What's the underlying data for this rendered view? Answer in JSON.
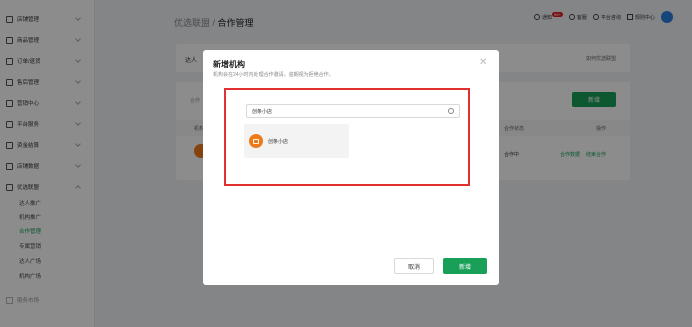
{
  "sidebar": {
    "items": [
      {
        "label": "店铺管理"
      },
      {
        "label": "商品管理"
      },
      {
        "label": "订单/退货"
      },
      {
        "label": "售后管理"
      },
      {
        "label": "营销中心"
      },
      {
        "label": "平台服务"
      },
      {
        "label": "资金结算"
      },
      {
        "label": "店铺数据"
      },
      {
        "label": "优选联盟"
      }
    ],
    "sub_items": [
      {
        "label": "达人推广"
      },
      {
        "label": "机构推广"
      },
      {
        "label": "合作管理"
      },
      {
        "label": "专属营销"
      },
      {
        "label": "达人广场"
      },
      {
        "label": "机构广场"
      }
    ],
    "bottom_label": "服务市场"
  },
  "header": {
    "breadcrumb_parent": "优选联盟",
    "separator": " / ",
    "breadcrumb_current": "合作管理",
    "actions": [
      {
        "label": "通知",
        "badge": "99+"
      },
      {
        "label": "客服"
      },
      {
        "label": "平台咨询"
      },
      {
        "label": "规则中心"
      }
    ]
  },
  "background": {
    "card1_title": "达人",
    "card1_link": "如何优选联盟",
    "new_button": "新增",
    "filter_label": "合作",
    "col_partner": "机构",
    "col_status": "合作状态",
    "col_action": "操作",
    "row_status": "合作中",
    "row_action1": "合作数据",
    "row_action2": "结束合作"
  },
  "modal": {
    "title": "新增机构",
    "subtitle": "机构会在24小时内处理合作邀请，逾期视为拒绝合作。",
    "search_value": "创条小店",
    "results": [
      {
        "name": "创条小店"
      }
    ],
    "cancel_label": "取消",
    "confirm_label": "新增"
  },
  "colors": {
    "accent": "#18a058",
    "highlight_border": "#e03030",
    "logo_orange": "#f07a1a"
  }
}
